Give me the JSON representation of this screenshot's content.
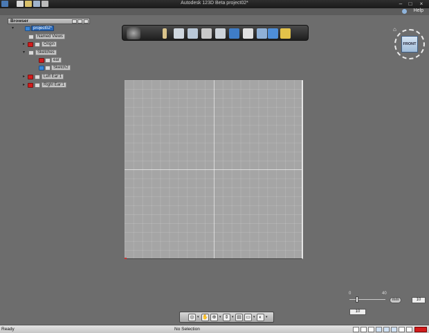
{
  "window": {
    "title": "Autodesk 123D Beta   project02*"
  },
  "helpbar": {
    "help_label": "Help"
  },
  "browser": {
    "title": "Browser",
    "nodes": [
      {
        "label": "project02*",
        "icon": "component-icon",
        "selected": true
      },
      {
        "label": "Named Views",
        "icon": "folder-icon"
      },
      {
        "label": "Origin",
        "icon": "folder-icon"
      },
      {
        "label": "Sketches",
        "icon": "folder-icon"
      },
      {
        "label": "ear",
        "icon": "sketch-icon"
      },
      {
        "label": "Sketch2",
        "icon": "sketch-icon"
      },
      {
        "label": "Left Ear:1",
        "icon": "component-icon"
      },
      {
        "label": "Right Ear:1",
        "icon": "component-icon"
      }
    ]
  },
  "viewcube": {
    "face_label": "FRONT"
  },
  "grid_controls": {
    "min_label": "0",
    "max_label": "40",
    "unit": "mm",
    "grid_size": "10",
    "snap_value": "10"
  },
  "status": {
    "left": "Ready",
    "center": "No Selection"
  },
  "colors": {
    "accent": "#2a68b6",
    "red_icon": "#d21c1c",
    "background": "#6d6d6d",
    "canvas": "#a5a5a5"
  }
}
